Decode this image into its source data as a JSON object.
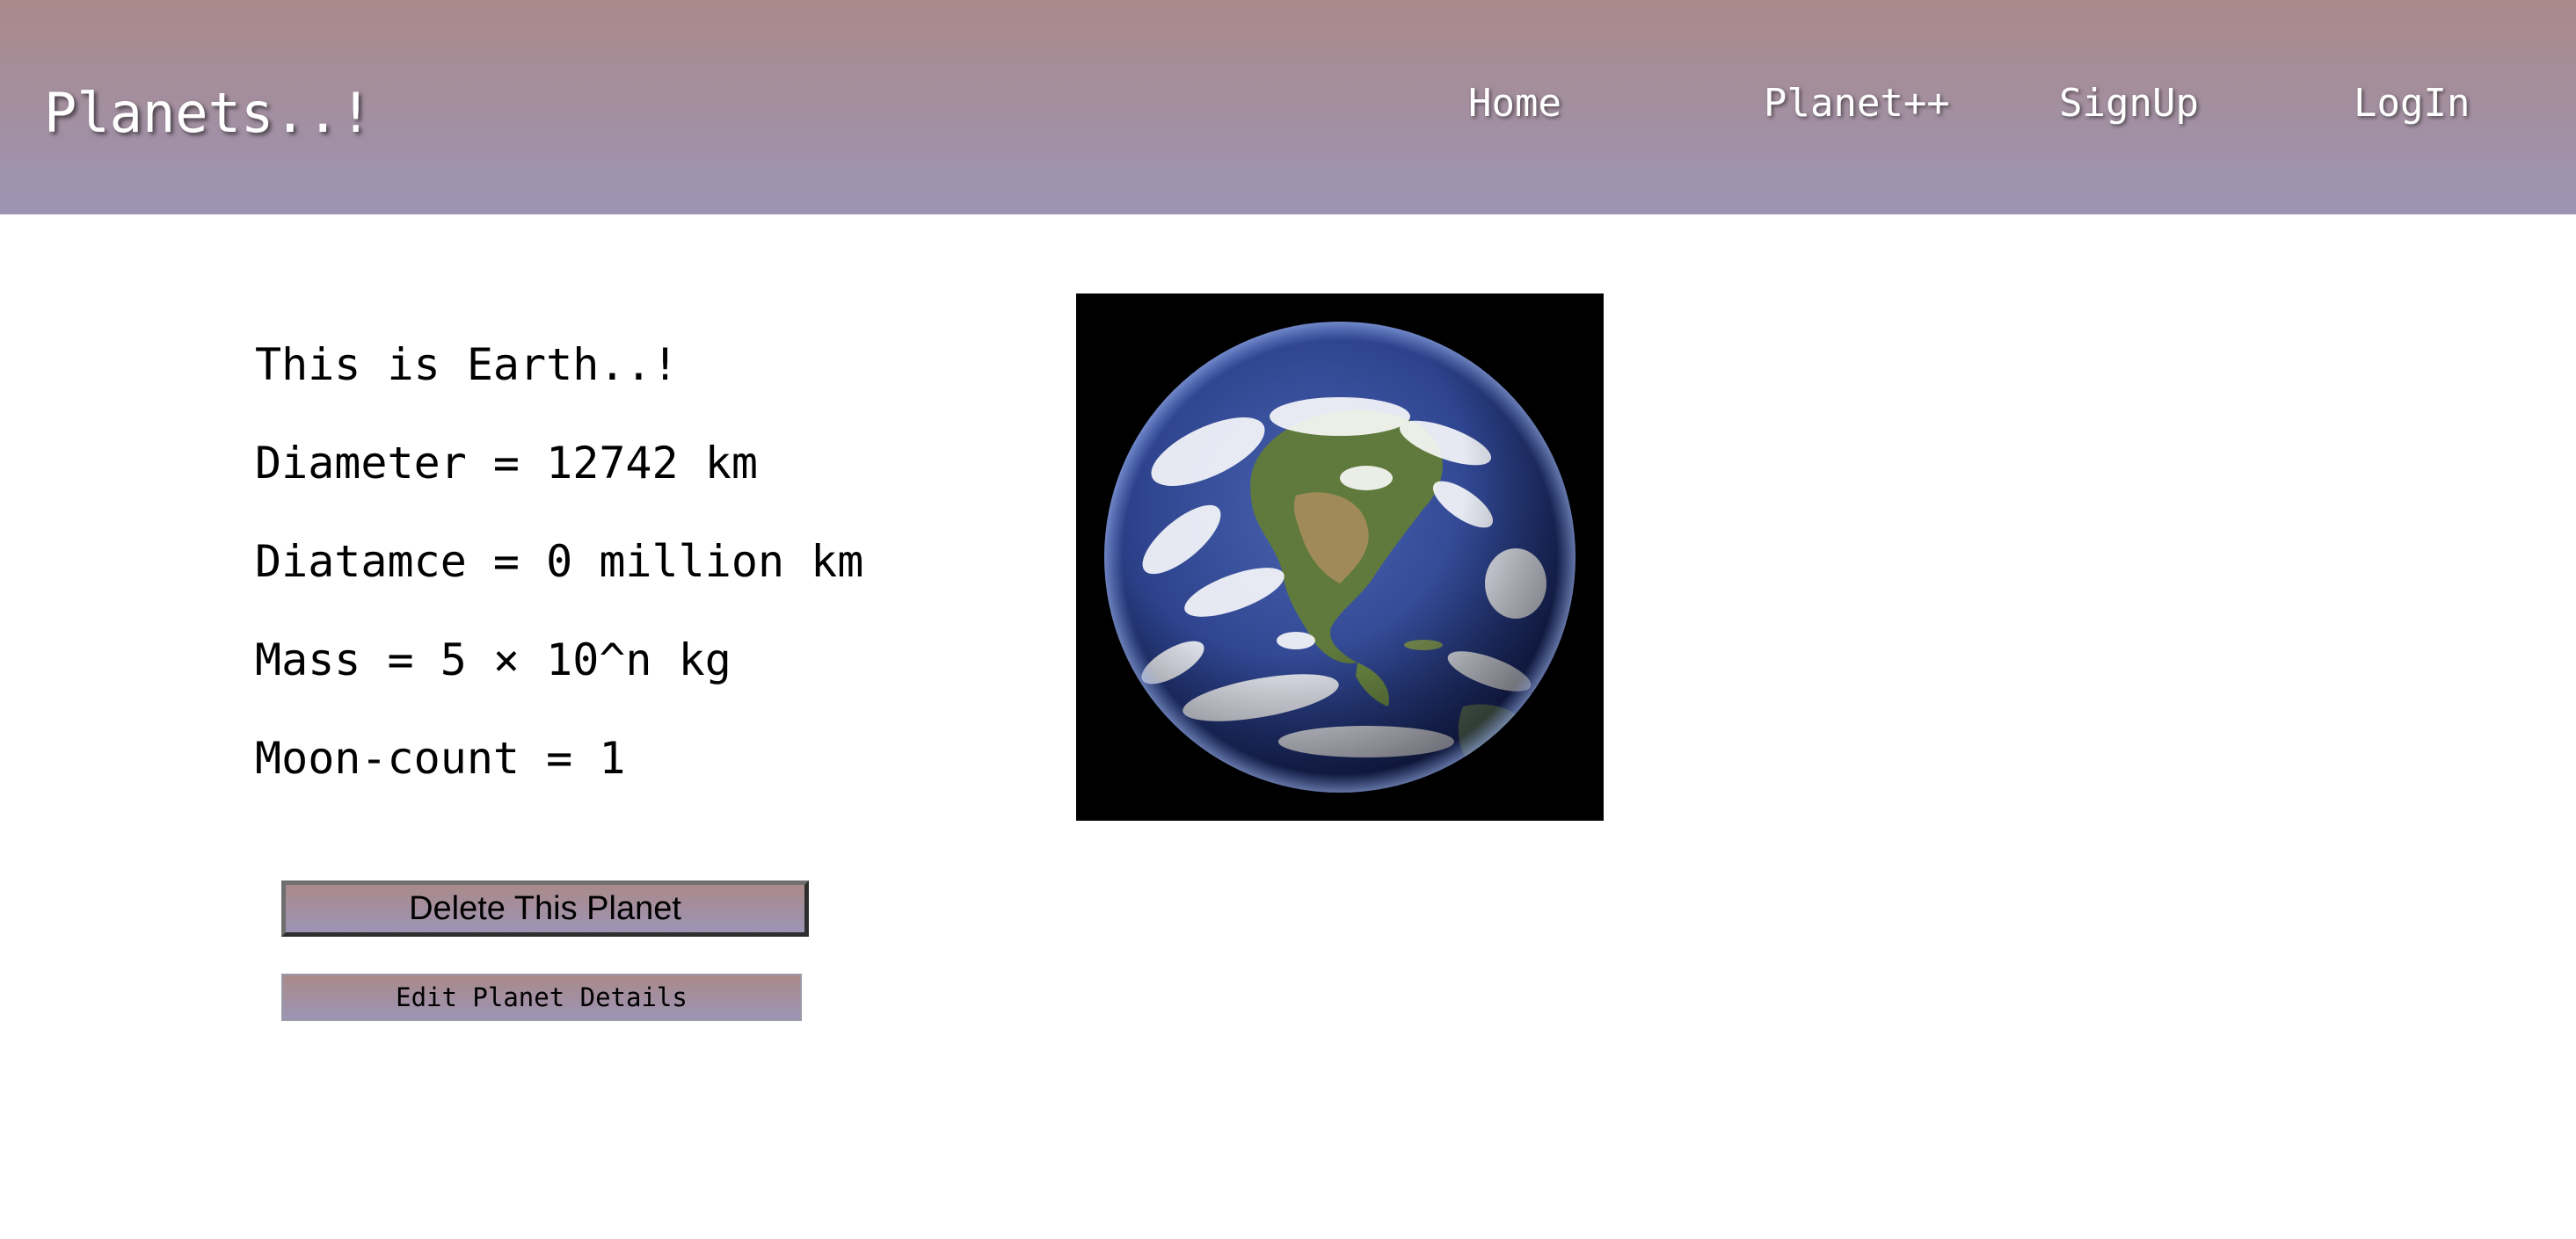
{
  "header": {
    "brand": "Planets..!",
    "nav": {
      "home": "Home",
      "planet_plus": "Planet++",
      "signup": "SignUp",
      "login": "LogIn"
    },
    "gradient_top": "#aa8a8a",
    "gradient_bottom": "#9c94b4"
  },
  "planet": {
    "title": "This is Earth..!",
    "diameter": "Diameter = 12742 km",
    "distance": "Diatamce = 0 million km",
    "mass": "Mass = 5 × 10^n kg",
    "moon_count": "Moon-count = 1",
    "image_icon": "earth-globe-photo"
  },
  "actions": {
    "delete_label": "Delete This Planet",
    "edit_label": "Edit Planet Details"
  }
}
